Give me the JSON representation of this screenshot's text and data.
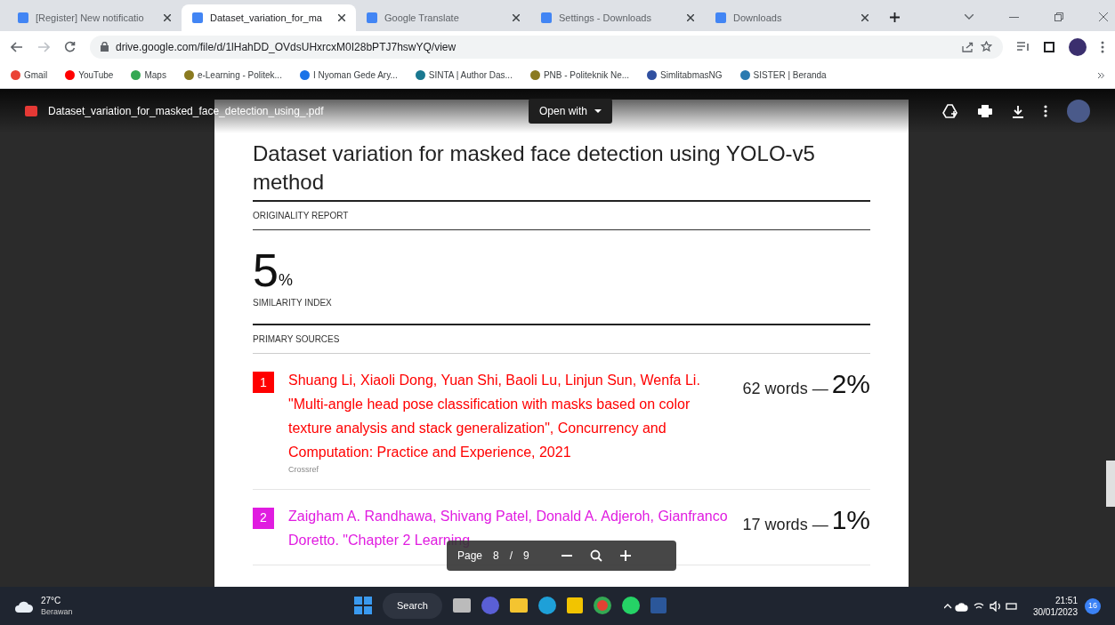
{
  "tabs": [
    {
      "label": "[Register] New notificatio",
      "selected": false
    },
    {
      "label": "Dataset_variation_for_ma",
      "selected": true
    },
    {
      "label": "Google Translate",
      "selected": false
    },
    {
      "label": "Settings - Downloads",
      "selected": false
    },
    {
      "label": "Downloads",
      "selected": false
    }
  ],
  "address": "drive.google.com/file/d/1lHahDD_OVdsUHxrcxM0I28bPTJ7hswYQ/view",
  "bookmarks": [
    "Gmail",
    "YouTube",
    "Maps",
    "e-Learning - Politek...",
    "I Nyoman Gede Ary...",
    "SINTA | Author Das...",
    "PNB - Politeknik Ne...",
    "SimlitabmasNG",
    "SISTER | Beranda"
  ],
  "viewer": {
    "file_name": "Dataset_variation_for_masked_face_detection_using_.pdf",
    "open_with": "Open with"
  },
  "report": {
    "title": "Dataset variation for masked face detection using YOLO-v5 method",
    "originality_label": "ORIGINALITY REPORT",
    "similarity": "5",
    "similarity_unit": "%",
    "similarity_label": "SIMILARITY INDEX",
    "sources_label": "PRIMARY SOURCES",
    "sources": [
      {
        "number": "1",
        "color": "#ff0000",
        "text": "Shuang Li, Xiaoli Dong, Yuan Shi, Baoli Lu, Linjun Sun, Wenfa Li. \"Multi‐angle head pose classification with masks based on color texture analysis and stack generalization\", Concurrency and Computation: Practice and Experience, 2021",
        "origin": "Crossref",
        "words": "62 words —",
        "percent": "2%"
      },
      {
        "number": "2",
        "color": "#e01ce0",
        "text": "Zaigham A. Randhawa, Shivang Patel, Donald A. Adjeroh, Gianfranco Doretto. \"Chapter 2 Learning",
        "words": "17 words —",
        "percent": "1%"
      }
    ]
  },
  "page_bar": {
    "label": "Page",
    "current": "8",
    "separator": "/",
    "total": "9"
  },
  "taskbar": {
    "temperature": "27°C",
    "weather": "Berawan",
    "search": "Search",
    "time": "21:51",
    "date": "30/01/2023",
    "badge": "16"
  }
}
